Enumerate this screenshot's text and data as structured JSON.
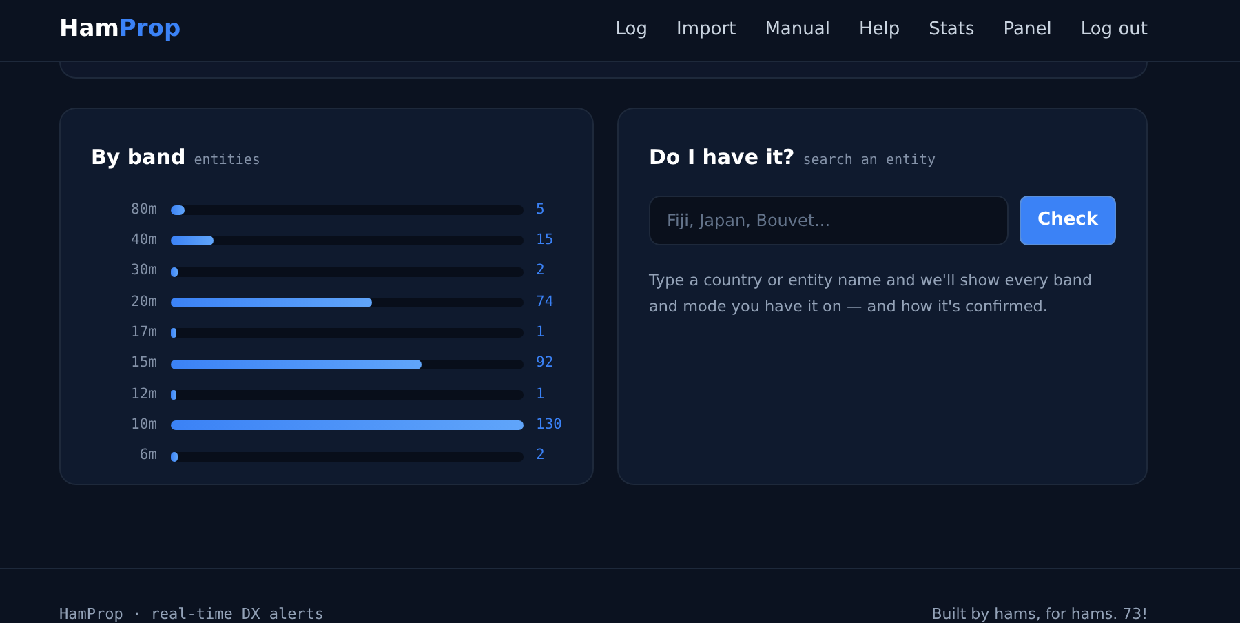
{
  "brand": {
    "first": "Ham",
    "second": "Prop"
  },
  "nav": [
    "Log",
    "Import",
    "Manual",
    "Help",
    "Stats",
    "Panel",
    "Log out"
  ],
  "band_card": {
    "title": "By band",
    "subtitle": "entities",
    "bands": [
      {
        "label": "80m",
        "level": 0.04,
        "value": "5"
      },
      {
        "label": "40m",
        "level": 0.12,
        "value": "15"
      },
      {
        "label": "30m",
        "level": 0.02,
        "value": "2"
      },
      {
        "label": "20m",
        "level": 0.57,
        "value": "74"
      },
      {
        "label": "17m",
        "level": 0.01,
        "value": "1"
      },
      {
        "label": "15m",
        "level": 0.71,
        "value": "92"
      },
      {
        "label": "12m",
        "level": 0.01,
        "value": "1"
      },
      {
        "label": "10m",
        "level": 1,
        "value": "130"
      },
      {
        "label": "6m",
        "level": 0.02,
        "value": "2"
      }
    ]
  },
  "search_card": {
    "title": "Do I have it?",
    "subtitle": "search an entity",
    "placeholder": "Fiji, Japan, Bouvet...",
    "button": "Check",
    "help": "Type a country or entity name and we'll show every band and mode you have it on — and how it's confirmed."
  },
  "footer": {
    "left": "HamProp · real-time DX alerts",
    "right": "Built by hams, for hams. 73!"
  }
}
